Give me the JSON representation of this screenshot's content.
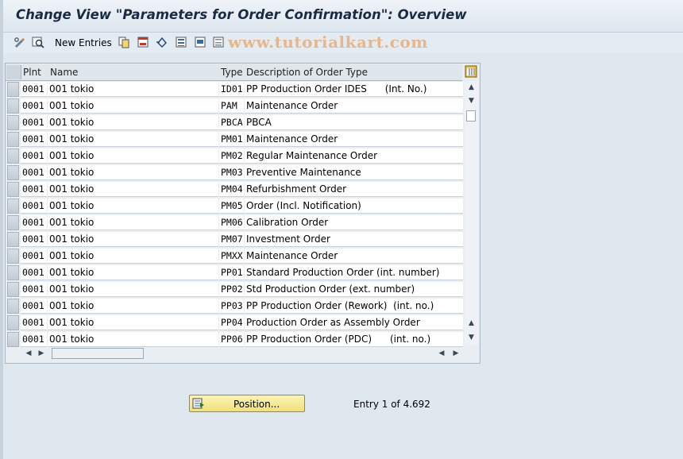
{
  "title": "Change View \"Parameters for Order Confirmation\": Overview",
  "toolbar": {
    "new_entries_label": "New Entries"
  },
  "watermark": "www.tutorialkart.com",
  "table": {
    "columns": [
      "Plnt",
      "Name",
      "Type",
      "Description of Order Type"
    ],
    "rows": [
      {
        "plnt": "0001",
        "name": "001 tokio",
        "type": "ID01",
        "desc": "PP Production Order IDES      (Int. No.)"
      },
      {
        "plnt": "0001",
        "name": "001 tokio",
        "type": "PAM",
        "desc": "Maintenance Order"
      },
      {
        "plnt": "0001",
        "name": "001 tokio",
        "type": "PBCA",
        "desc": "PBCA"
      },
      {
        "plnt": "0001",
        "name": "001 tokio",
        "type": "PM01",
        "desc": "Maintenance Order"
      },
      {
        "plnt": "0001",
        "name": "001 tokio",
        "type": "PM02",
        "desc": "Regular Maintenance Order"
      },
      {
        "plnt": "0001",
        "name": "001 tokio",
        "type": "PM03",
        "desc": "Preventive Maintenance"
      },
      {
        "plnt": "0001",
        "name": "001 tokio",
        "type": "PM04",
        "desc": "Refurbishment Order"
      },
      {
        "plnt": "0001",
        "name": "001 tokio",
        "type": "PM05",
        "desc": "Order (Incl. Notification)"
      },
      {
        "plnt": "0001",
        "name": "001 tokio",
        "type": "PM06",
        "desc": "Calibration Order"
      },
      {
        "plnt": "0001",
        "name": "001 tokio",
        "type": "PM07",
        "desc": "Investment Order"
      },
      {
        "plnt": "0001",
        "name": "001 tokio",
        "type": "PMXX",
        "desc": "Maintenance Order"
      },
      {
        "plnt": "0001",
        "name": "001 tokio",
        "type": "PP01",
        "desc": "Standard Production Order (int. number)"
      },
      {
        "plnt": "0001",
        "name": "001 tokio",
        "type": "PP02",
        "desc": "Std Production Order (ext. number)"
      },
      {
        "plnt": "0001",
        "name": "001 tokio",
        "type": "PP03",
        "desc": "PP Production Order (Rework)  (int. no.)"
      },
      {
        "plnt": "0001",
        "name": "001 tokio",
        "type": "PP04",
        "desc": "Production Order as Assembly Order"
      },
      {
        "plnt": "0001",
        "name": "001 tokio",
        "type": "PP06",
        "desc": "PP Production Order (PDC)      (int. no.)"
      }
    ]
  },
  "position_button_label": "Position...",
  "entry_info": "Entry 1 of 4.692"
}
